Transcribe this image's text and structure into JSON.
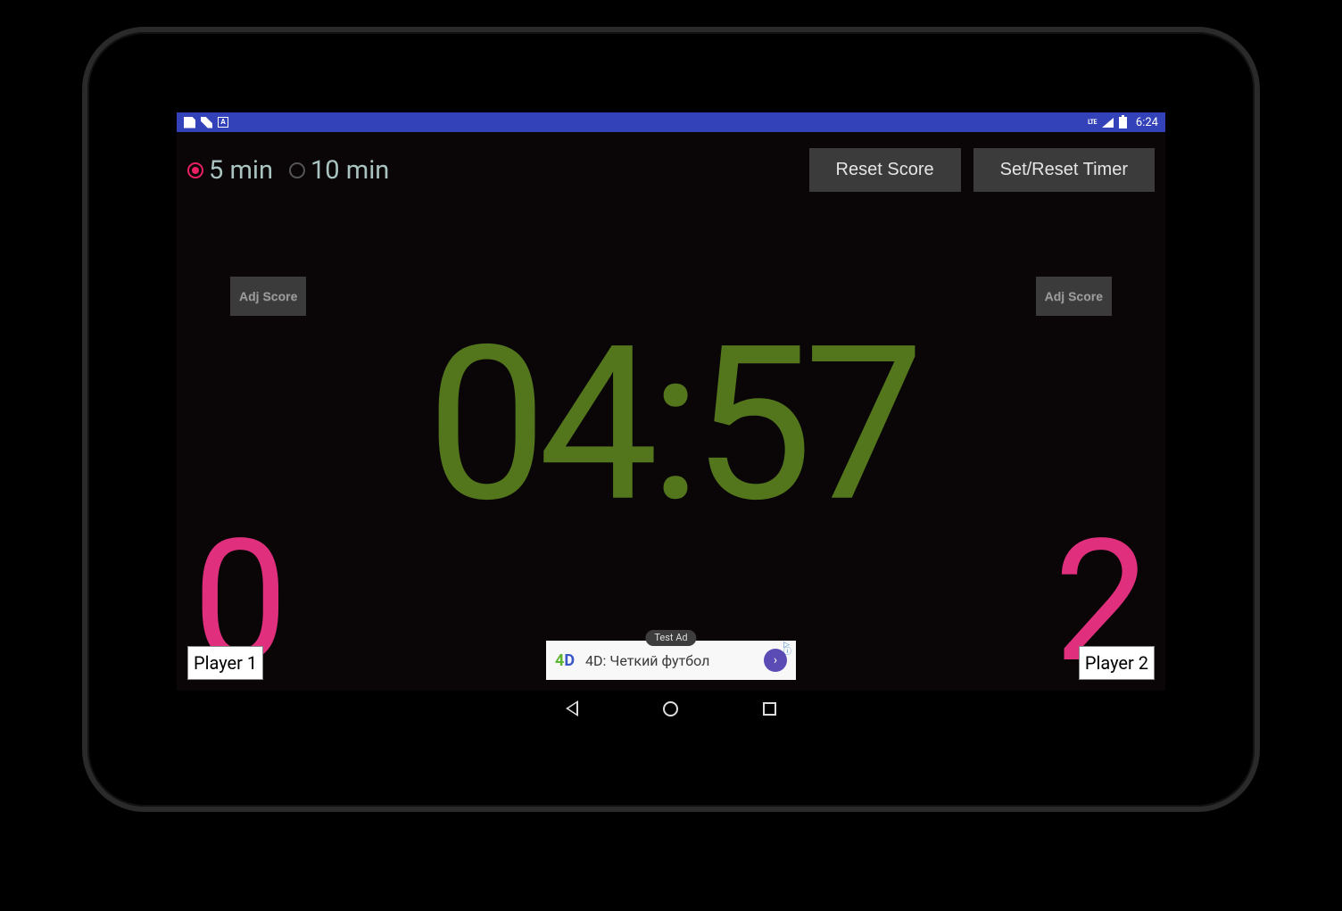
{
  "status": {
    "lte": "LTE",
    "time": "6:24",
    "a_letter": "A"
  },
  "duration": {
    "five": "5 min",
    "ten": "10 min",
    "selected": "five"
  },
  "buttons": {
    "reset_score": "Reset Score",
    "set_reset_timer": "Set/Reset Timer",
    "adj_score": "Adj Score"
  },
  "timer": "04:57",
  "scores": {
    "p1": "0",
    "p2": "2"
  },
  "players": {
    "p1": "Player 1",
    "p2": "Player 2"
  },
  "ad": {
    "badge": "Test Ad",
    "text": "4D: Четкий футбол",
    "arrow": "›",
    "corner": "▷ ⓘ",
    "logo_4": "4",
    "logo_d": "D"
  },
  "colors": {
    "accent_pink": "#e0307d",
    "olive": "#53751c",
    "status_blue": "#3342b8"
  }
}
